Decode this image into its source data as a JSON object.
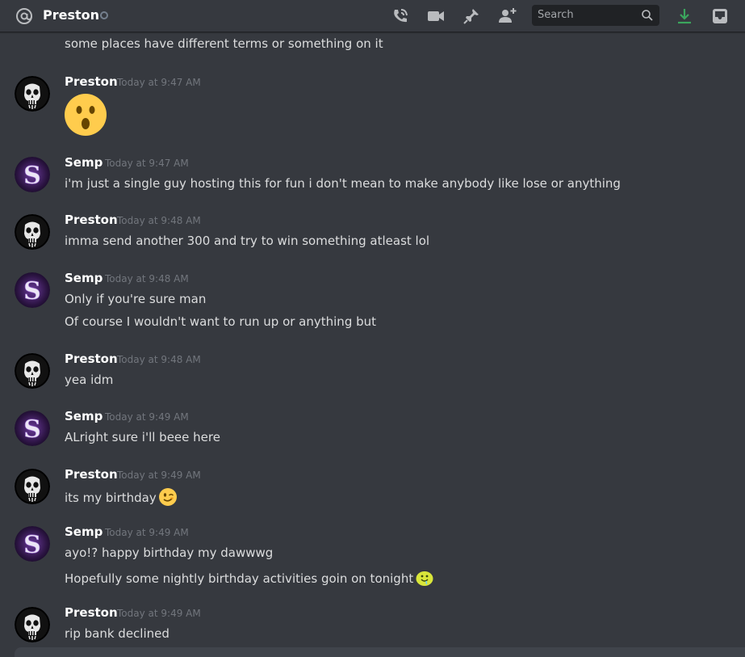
{
  "header": {
    "channel_name": "Preston",
    "search_placeholder": "Search",
    "icons": [
      "at-icon",
      "voice-call-icon",
      "video-call-icon",
      "pin-icon",
      "add-friend-icon",
      "search-icon",
      "download-icon",
      "inbox-icon"
    ],
    "colors": {
      "download": "#3ba55d",
      "background": "#36393f",
      "status_offline": "#747f8d"
    }
  },
  "fragment": {
    "text": "some places have different terms or something on it"
  },
  "messages": [
    {
      "author": "Preston",
      "time": "Today at 9:47 AM",
      "lines": [],
      "emoji": "astonished-emoji"
    },
    {
      "author": "Semp",
      "time": "Today at 9:47 AM",
      "lines": [
        "i'm just a single guy hosting this for fun i don't mean to make anybody like lose or anything"
      ]
    },
    {
      "author": "Preston",
      "time": "Today at 9:48 AM",
      "lines": [
        "imma send another 300 and try to win something atleast lol"
      ]
    },
    {
      "author": "Semp",
      "time": "Today at 9:48 AM",
      "lines": [
        "Only if you're sure man",
        "Of course I wouldn't want to run up or anything but"
      ]
    },
    {
      "author": "Preston",
      "time": "Today at 9:48 AM",
      "lines": [
        "yea idm"
      ]
    },
    {
      "author": "Semp",
      "time": "Today at 9:49 AM",
      "lines": [
        "ALright sure i'll beee here"
      ]
    },
    {
      "author": "Preston",
      "time": "Today at 9:49 AM",
      "lines": [
        "its my birthday"
      ],
      "emoji": "wink-emoji"
    },
    {
      "author": "Semp",
      "time": "Today at 9:49 AM",
      "lines": [
        "ayo!? happy birthday my dawwwg",
        "Hopefully some nightly birthday activities goin on tonight"
      ],
      "emoji": "drool-emoji"
    },
    {
      "author": "Preston",
      "time": "Today at 9:49 AM",
      "lines": [
        "rip bank declined"
      ]
    }
  ]
}
